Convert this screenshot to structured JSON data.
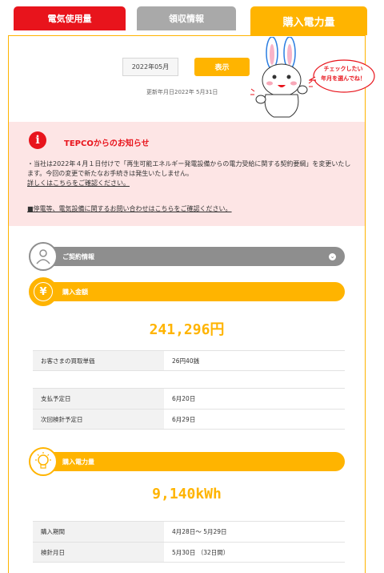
{
  "tabs": [
    {
      "label": "電気使用量",
      "color": "#e8141c"
    },
    {
      "label": "領収情報",
      "color": "#a9a9a9"
    },
    {
      "label": "購入電力量",
      "color": "#ffb400",
      "active": true
    }
  ],
  "selector": {
    "month_value": "2022年05月",
    "show_label": "表示",
    "updated_text": "更新年月日2022年 5月31日"
  },
  "mascot": {
    "bubble_text_line1": "チェックしたい",
    "bubble_text_line2": "年月を選んでね！"
  },
  "notice": {
    "icon_glyph": "i",
    "title": "TEPCOからのお知らせ",
    "body": "・当社は2022年４月１日付けで「再生可能エネルギー発電設備からの電力受給に関する契約要綱」を変更いたします。今回の変更で新たなお手続きは発生いたしません。",
    "link1": "詳しくはこちらをご確認ください。",
    "link2": "■停電等、電気設備に関するお問い合わせはこちらをご確認ください。"
  },
  "contract": {
    "label": "ご契約情報",
    "chevron": "⌄"
  },
  "purchase_amount": {
    "label": "購入金額",
    "icon_glyph": "¥",
    "total": "241,296円",
    "rows": [
      {
        "key": "お客さまの買取単価",
        "value": "26円40銭"
      }
    ],
    "rows2": [
      {
        "key": "支払予定日",
        "value": "6月20日"
      },
      {
        "key": "次回検針予定日",
        "value": "6月29日"
      }
    ]
  },
  "purchase_power": {
    "label": "購入電力量",
    "total": "9,140kWh",
    "rows": [
      {
        "key": "購入期間",
        "value": "4月28日～ 5月29日"
      },
      {
        "key": "検針月日",
        "value": "5月30日 （32日間）"
      }
    ]
  },
  "colors": {
    "red": "#e8141c",
    "yellow": "#ffb400",
    "gray": "#8e8e8e",
    "notice_bg": "#fde5e5"
  }
}
